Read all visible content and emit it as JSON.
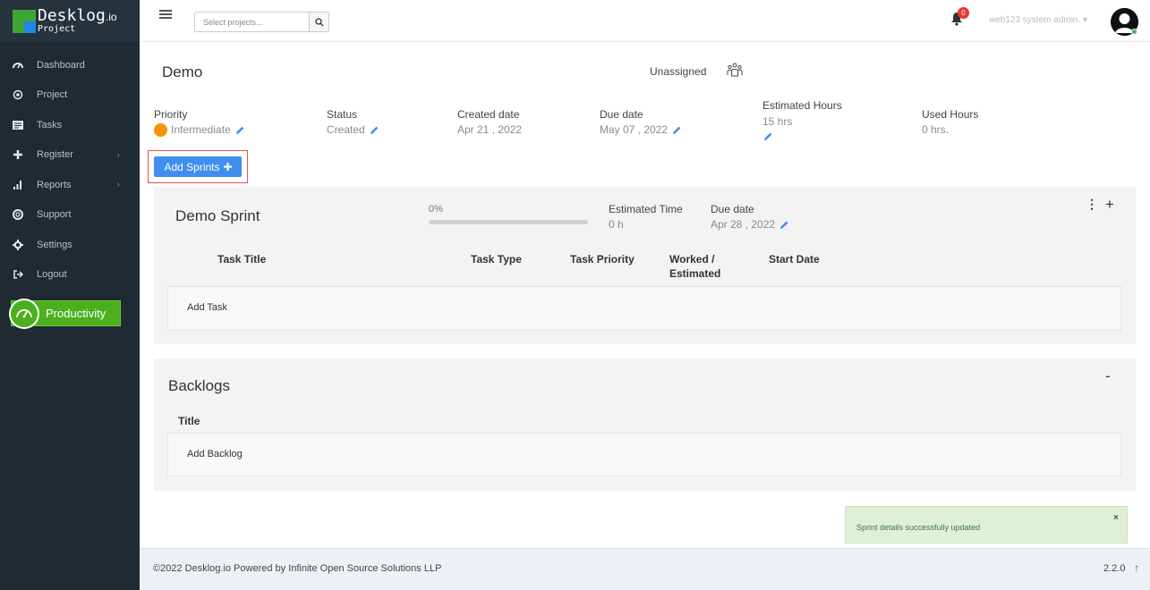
{
  "brand": {
    "name": "Desklog",
    "suffix": ".io",
    "sub": "Project"
  },
  "sidebar": {
    "items": [
      {
        "label": "Dashboard",
        "icon": "dashboard-icon"
      },
      {
        "label": "Project",
        "icon": "project-icon"
      },
      {
        "label": "Tasks",
        "icon": "tasks-icon"
      },
      {
        "label": "Register",
        "icon": "plus-icon",
        "caret": "›"
      },
      {
        "label": "Reports",
        "icon": "bar-chart-icon",
        "caret": "›"
      },
      {
        "label": "Support",
        "icon": "support-icon"
      },
      {
        "label": "Settings",
        "icon": "gear-icon"
      },
      {
        "label": "Logout",
        "icon": "logout-icon"
      }
    ],
    "productivity_label": "Productivity"
  },
  "header": {
    "search_placeholder": "Select projects...",
    "notification_count": "0",
    "user_name": "web123 system admin. ▾"
  },
  "project": {
    "title": "Demo",
    "assignee": "Unassigned",
    "priority_label": "Priority",
    "priority_value": "Intermediate",
    "status_label": "Status",
    "status_value": "Created",
    "created_label": "Created date",
    "created_value": "Apr 21 , 2022",
    "due_label": "Due date",
    "due_value": "May 07 , 2022",
    "est_label": "Estimated Hours",
    "est_value": "15 hrs",
    "used_label": "Used Hours",
    "used_value": "0 hrs.",
    "add_sprints_label": "Add Sprints"
  },
  "sprint": {
    "name": "Demo Sprint",
    "progress_text": "0%",
    "progress": 0,
    "est_time_label": "Estimated Time",
    "est_time_value": "0  h",
    "due_label": "Due date",
    "due_value": "Apr 28 , 2022",
    "columns": {
      "title": "Task Title",
      "type": "Task Type",
      "priority": "Task Priority",
      "worked_line1": "Worked /",
      "worked_line2": "Estimated",
      "start": "Start Date"
    },
    "add_task_label": "Add Task"
  },
  "backlog": {
    "title": "Backlogs",
    "collapse_label": "-",
    "column_title": "Title",
    "add_label": "Add Backlog"
  },
  "toast": {
    "message": "Sprint details successfully updated",
    "close": "×"
  },
  "footer": {
    "copyright": "©2022 Desklog.io Powered by Infinite Open Source Solutions LLP",
    "version": "2.2.0"
  },
  "colors": {
    "sidebar_bg": "#1f2a33",
    "accent_blue": "#3f8ef0",
    "productivity_green": "#4caf1e",
    "priority_orange": "#f59300",
    "highlight_red": "#e05555"
  }
}
